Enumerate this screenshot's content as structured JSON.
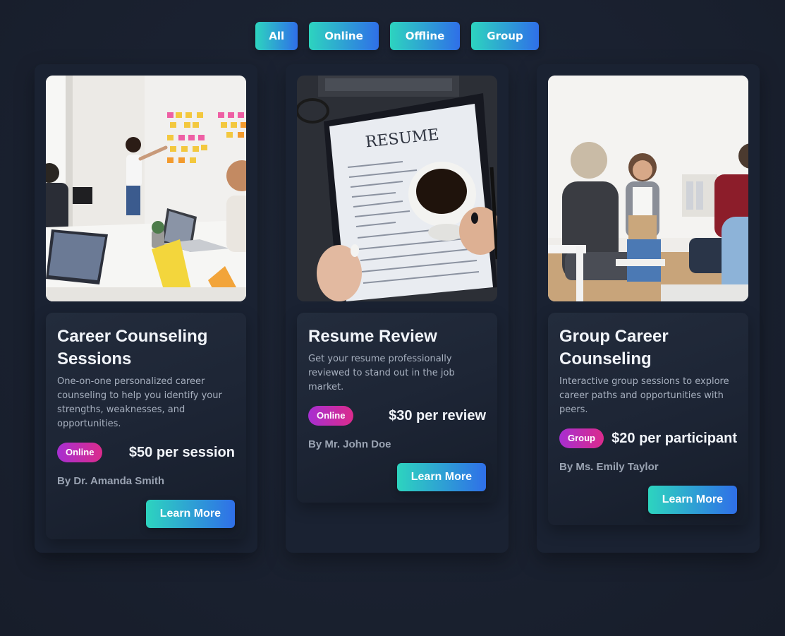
{
  "filters": [
    {
      "label": "All"
    },
    {
      "label": "Online"
    },
    {
      "label": "Offline"
    },
    {
      "label": "Group"
    }
  ],
  "cards": [
    {
      "title": "Career Counseling Sessions",
      "description": "One-on-one personalized career counseling to help you identify your strengths, weaknesses, and opportunities.",
      "badge": "Online",
      "price": "$50 per session",
      "author": "By Dr. Amanda Smith",
      "button": "Learn More",
      "image": "team-meeting-whiteboard-photo"
    },
    {
      "title": "Resume Review",
      "description": "Get your resume professionally reviewed to stand out in the job market.",
      "badge": "Online",
      "price": "$30 per review",
      "author": "By Mr. John Doe",
      "button": "Learn More",
      "image": "resume-coffee-photo",
      "image_text": "RESUME"
    },
    {
      "title": "Group Career Counseling",
      "description": "Interactive group sessions to explore career paths and opportunities with peers.",
      "badge": "Group",
      "price": "$20 per participant",
      "author": "By Ms. Emily Taylor",
      "button": "Learn More",
      "image": "group-session-photo"
    }
  ],
  "colors": {
    "accent_start": "#2dd4bf",
    "accent_end": "#2f6fe8",
    "badge_start": "#a72fd1",
    "badge_end": "#db2b8c",
    "background": "#1a2130"
  }
}
